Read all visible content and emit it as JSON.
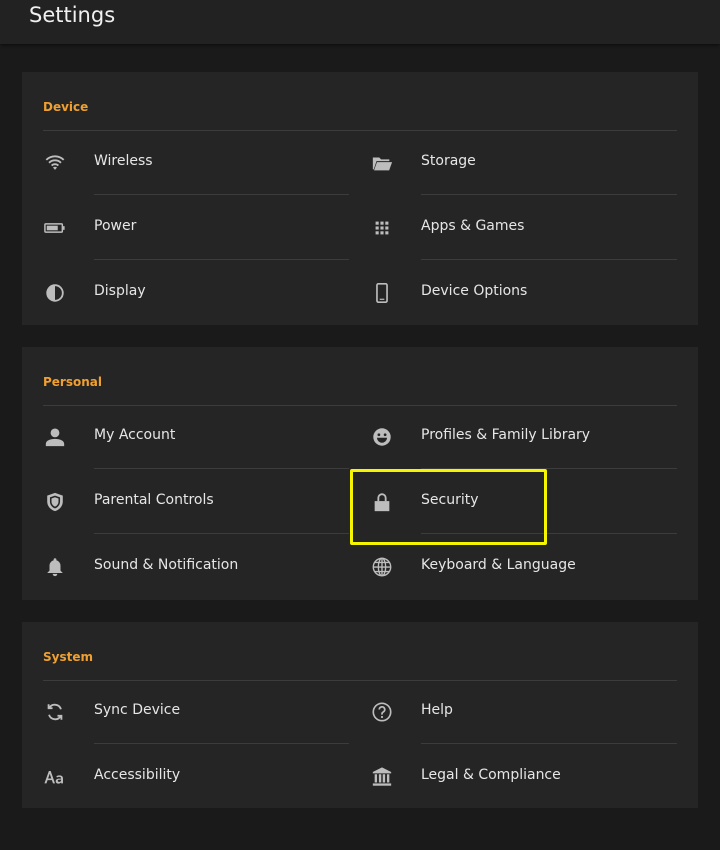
{
  "header": {
    "title": "Settings"
  },
  "sections": [
    {
      "label": "Device",
      "items": [
        {
          "label": "Wireless",
          "icon": "wifi-icon"
        },
        {
          "label": "Storage",
          "icon": "folder-icon"
        },
        {
          "label": "Power",
          "icon": "battery-icon"
        },
        {
          "label": "Apps & Games",
          "icon": "apps-grid-icon"
        },
        {
          "label": "Display",
          "icon": "contrast-icon"
        },
        {
          "label": "Device Options",
          "icon": "phone-icon"
        }
      ]
    },
    {
      "label": "Personal",
      "items": [
        {
          "label": "My Account",
          "icon": "person-icon"
        },
        {
          "label": "Profiles & Family Library",
          "icon": "smiley-icon"
        },
        {
          "label": "Parental Controls",
          "icon": "shield-icon"
        },
        {
          "label": "Security",
          "icon": "lock-icon"
        },
        {
          "label": "Sound & Notification",
          "icon": "bell-icon"
        },
        {
          "label": "Keyboard & Language",
          "icon": "globe-icon"
        }
      ]
    },
    {
      "label": "System",
      "items": [
        {
          "label": "Sync Device",
          "icon": "sync-icon"
        },
        {
          "label": "Help",
          "icon": "help-icon"
        },
        {
          "label": "Accessibility",
          "icon": "text-size-icon"
        },
        {
          "label": "Legal & Compliance",
          "icon": "legal-building-icon"
        }
      ]
    }
  ],
  "colors": {
    "background": "#1a1a1a",
    "panel": "#252525",
    "section_label": "#f0a030",
    "highlight": "#f5f500",
    "icon": "#bdbdbd"
  }
}
